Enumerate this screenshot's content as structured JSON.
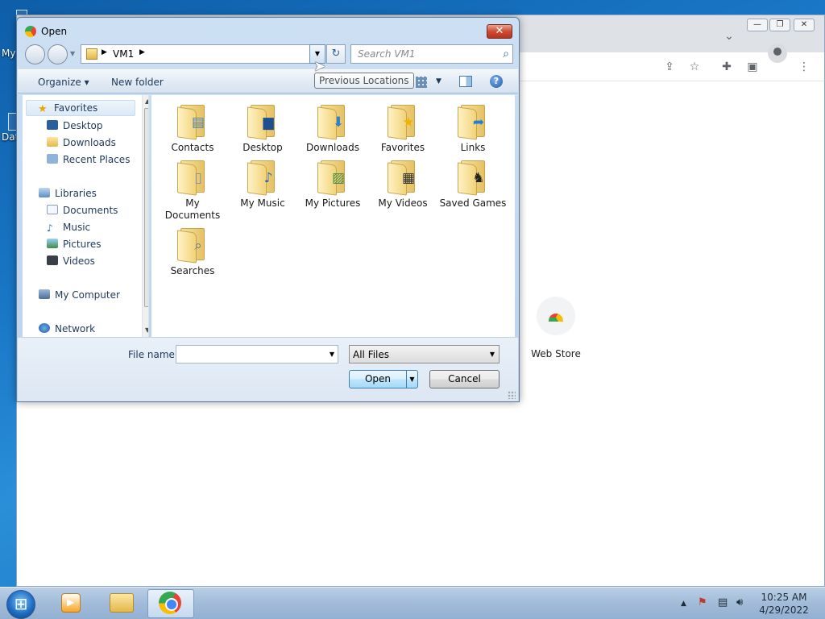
{
  "desktop": {
    "labels": [
      "My",
      "Dat"
    ]
  },
  "chrome": {
    "window_controls": [
      "—",
      "❐",
      "✕"
    ],
    "tab_menu": "⌄",
    "web_store_label": "Web Store"
  },
  "dialog": {
    "title": "Open",
    "close": "✕",
    "address": {
      "crumb": "VM1",
      "arrow": "▶"
    },
    "search_placeholder": "Search VM1",
    "toolbar": {
      "organize": "Organize ▾",
      "new_folder": "New folder"
    },
    "tooltip": "Previous Locations",
    "nav": {
      "favorites": "Favorites",
      "favorites_items": [
        "Desktop",
        "Downloads",
        "Recent Places"
      ],
      "libraries": "Libraries",
      "libraries_items": [
        "Documents",
        "Music",
        "Pictures",
        "Videos"
      ],
      "computer": "My Computer",
      "network": "Network"
    },
    "files": [
      {
        "name": "Contacts",
        "icon": "contacts-card"
      },
      {
        "name": "Desktop",
        "icon": "desktop-screen"
      },
      {
        "name": "Downloads",
        "icon": "download-arrow"
      },
      {
        "name": "Favorites",
        "icon": "star"
      },
      {
        "name": "Links",
        "icon": "link-arrow"
      },
      {
        "name": "My Documents",
        "icon": "document-page"
      },
      {
        "name": "My Music",
        "icon": "music-note"
      },
      {
        "name": "My Pictures",
        "icon": "picture"
      },
      {
        "name": "My Videos",
        "icon": "film-strip"
      },
      {
        "name": "Saved Games",
        "icon": "chess-piece"
      },
      {
        "name": "Searches",
        "icon": "magnifier"
      }
    ],
    "file_name_label": "File name:",
    "file_name_value": "",
    "filter": "All Files",
    "open_button": "Open",
    "cancel_button": "Cancel"
  },
  "taskbar": {
    "time": "10:25 AM",
    "date": "4/29/2022"
  }
}
